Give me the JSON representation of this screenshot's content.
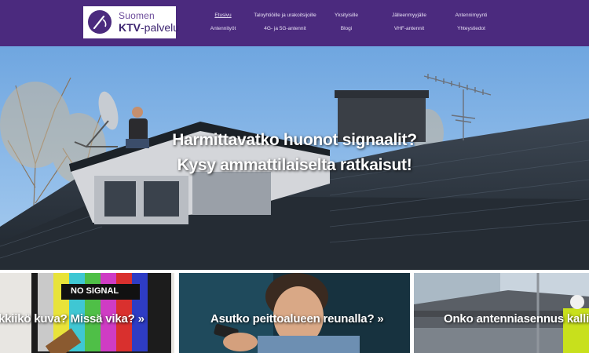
{
  "logo": {
    "line1": "Suomen",
    "line2_bold": "KTV",
    "line2_rest": "-palvelu"
  },
  "nav": {
    "row1": [
      "Etusivu",
      "Taloyhtiöille ja urakoitsijoille",
      "Yksityisille",
      "Jälleenmyyjälle",
      "Antennimyynti"
    ],
    "row2": [
      "Antennityöt",
      "4G- ja 5G-antennit",
      "Blogi",
      "VHF-antennit",
      "Yhteystiedot"
    ],
    "active": "Etusivu"
  },
  "hero": {
    "line1": "Harmittavatko huonot signaalit?",
    "line2": "Kysy ammattilaiselta ratkaisut!"
  },
  "cards": [
    {
      "label": "kkiikö kuva? Missä vika? »",
      "screen_text": "NO SIGNAL"
    },
    {
      "label": "Asutko peittoalueen reunalla? »"
    },
    {
      "label": "Onko antenniasennus kallis"
    }
  ],
  "colors": {
    "header_bg": "#4b2a7e",
    "nav_text": "#e9e2f5",
    "logo_purple": "#3c2470"
  }
}
